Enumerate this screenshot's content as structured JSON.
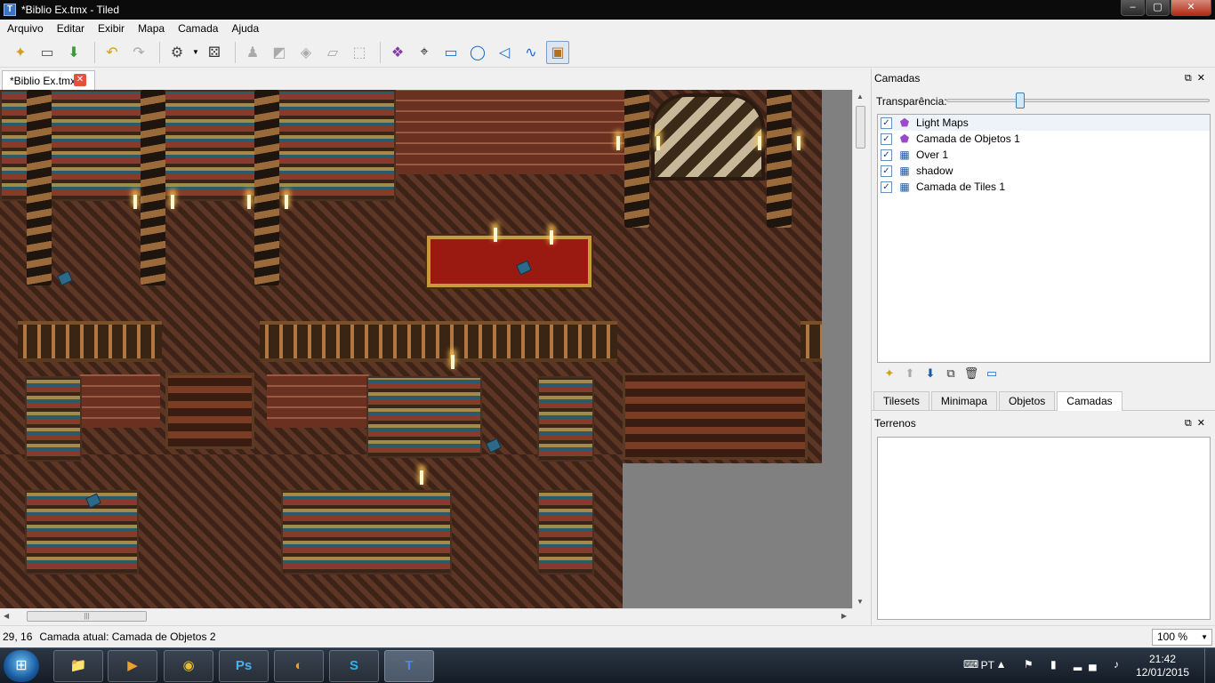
{
  "window": {
    "title": "*Biblio Ex.tmx - Tiled",
    "app_icon": "T"
  },
  "window_buttons": {
    "minimize": "–",
    "maximize": "▢",
    "close": "✕"
  },
  "menu": [
    "Arquivo",
    "Editar",
    "Exibir",
    "Mapa",
    "Camada",
    "Ajuda"
  ],
  "toolbar": {
    "buttons": [
      {
        "name": "new-file",
        "glyph": "✦"
      },
      {
        "name": "open-file",
        "glyph": "▭"
      },
      {
        "name": "save-file",
        "glyph": "⬇"
      },
      {
        "name": "undo",
        "glyph": "↶"
      },
      {
        "name": "redo",
        "glyph": "↷"
      },
      {
        "name": "commands",
        "glyph": "⚙"
      },
      {
        "name": "random-mode",
        "glyph": "⚄"
      },
      {
        "name": "stamp-brush",
        "glyph": "♟"
      },
      {
        "name": "terrain-brush",
        "glyph": "◩"
      },
      {
        "name": "bucket-fill",
        "glyph": "◈"
      },
      {
        "name": "eraser",
        "glyph": "▱"
      },
      {
        "name": "rectangle-select",
        "glyph": "⬚"
      },
      {
        "name": "magic-wand",
        "glyph": "❖"
      },
      {
        "name": "select-objects",
        "glyph": "⌖"
      },
      {
        "name": "insert-rectangle",
        "glyph": "▭"
      },
      {
        "name": "insert-ellipse",
        "glyph": "◯"
      },
      {
        "name": "insert-polygon",
        "glyph": "◁"
      },
      {
        "name": "insert-polyline",
        "glyph": "∿"
      },
      {
        "name": "insert-tile",
        "glyph": "▣"
      }
    ]
  },
  "document_tab": {
    "label": "*Biblio Ex.tmx",
    "close": "✕"
  },
  "scroll": {
    "up": "▲",
    "down": "▼",
    "left": "◀",
    "right": "▶",
    "grip": "|||"
  },
  "status": {
    "coords": "29, 16",
    "current_layer": "Camada atual: Camada de Objetos 2",
    "zoom": "100 %",
    "zoom_dropdown": "▼"
  },
  "layers_panel": {
    "title": "Camadas",
    "controls": "⧉✕",
    "opacity_label": "Transparência:",
    "opacity_value": 0.27,
    "layers": [
      {
        "name": "Light Maps",
        "type": "object",
        "visible": true,
        "selected": true
      },
      {
        "name": "Camada de Objetos 1",
        "type": "object",
        "visible": true,
        "selected": false
      },
      {
        "name": "Over 1",
        "type": "tile",
        "visible": true,
        "selected": false
      },
      {
        "name": "shadow",
        "type": "tile",
        "visible": true,
        "selected": false
      },
      {
        "name": "Camada de Tiles 1",
        "type": "tile",
        "visible": true,
        "selected": false
      }
    ],
    "check_glyph": "✓",
    "object_icon": "⬟",
    "tile_icon": "▦",
    "tools": [
      "✦",
      "⬆",
      "⬇",
      "⧉",
      "🗑",
      "▭"
    ]
  },
  "dock_tabs": [
    "Tilesets",
    "Minimapa",
    "Objetos",
    "Camadas"
  ],
  "active_dock_tab": "Camadas",
  "terrain_panel": {
    "title": "Terrenos",
    "controls": "⧉✕"
  },
  "taskbar": {
    "start": "⊞",
    "apps": [
      {
        "name": "explorer",
        "glyph": "📁"
      },
      {
        "name": "media-player",
        "glyph": "▶"
      },
      {
        "name": "chrome",
        "glyph": "◉"
      },
      {
        "name": "photoshop",
        "glyph": "Ps"
      },
      {
        "name": "launcher",
        "glyph": "◐"
      },
      {
        "name": "skype",
        "glyph": "S"
      },
      {
        "name": "tiled",
        "glyph": "T"
      }
    ],
    "language": "PT",
    "tray_icons": "⌨ ▲ ⚑ ▮ ▂▄ ♪",
    "time": "21:42",
    "date": "12/01/2015"
  }
}
